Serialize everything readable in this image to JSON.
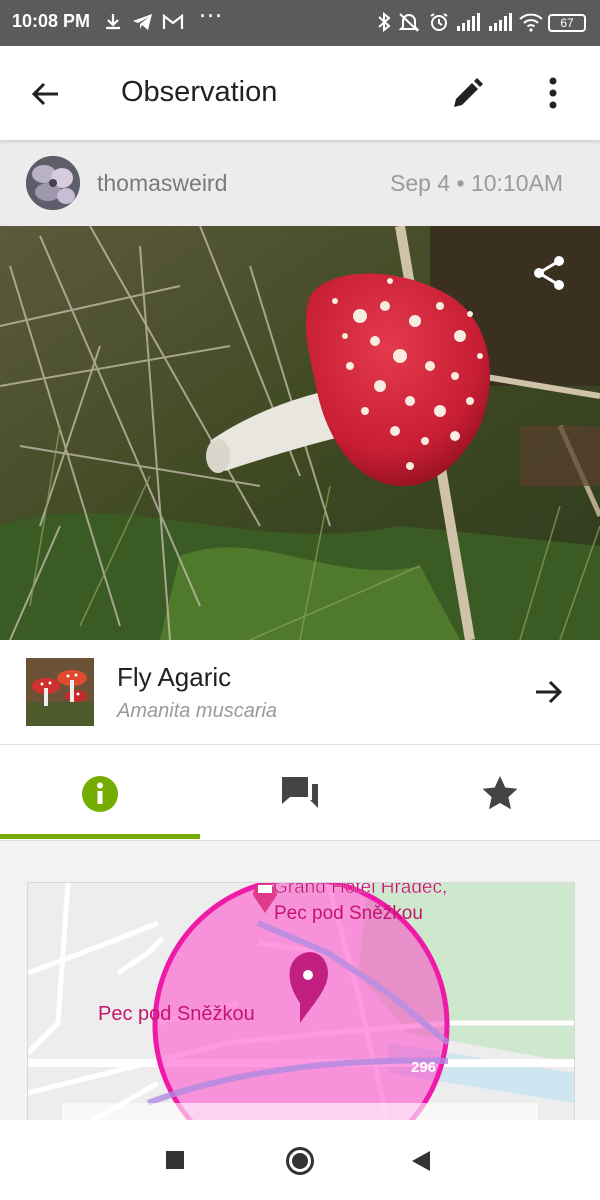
{
  "status_bar": {
    "time": "10:08 PM",
    "left_icons": [
      "download-icon",
      "telegram-icon",
      "gmail-icon",
      "more-dots-icon"
    ],
    "right_icons": [
      "bluetooth-icon",
      "mute-icon",
      "alarm-icon",
      "signal-icon",
      "signal-icon",
      "wifi-icon"
    ],
    "battery": "67",
    "overflow_dots": "···"
  },
  "app_bar": {
    "title": "Observation",
    "back_icon": "arrow-back-icon",
    "edit_icon": "pencil-icon",
    "menu_icon": "more-vert-icon"
  },
  "user": {
    "username": "thomasweird",
    "timestamp": "Sep 4 • 10:10AM"
  },
  "photo": {
    "share_icon": "share-icon"
  },
  "taxon": {
    "common_name": "Fly Agaric",
    "scientific_name": "Amanita muscaria",
    "arrow_icon": "arrow-forward-icon"
  },
  "tabs": [
    {
      "name": "info",
      "icon": "info-icon",
      "active": true
    },
    {
      "name": "comments",
      "icon": "chat-icon",
      "active": false
    },
    {
      "name": "favorites",
      "icon": "star-icon",
      "active": false
    }
  ],
  "map": {
    "poi_label_line1": "Grand Hotel Hradec,",
    "poi_label_line2": "Pec pod Sněžkou",
    "place_label": "Pec pod Sněžkou",
    "road_number": "296"
  },
  "nav_bar": {
    "icons": [
      "recents-square-icon",
      "home-circle-icon",
      "back-triangle-icon"
    ]
  },
  "colors": {
    "accent_green": "#74ac00",
    "map_circle": "#ff38c7"
  }
}
